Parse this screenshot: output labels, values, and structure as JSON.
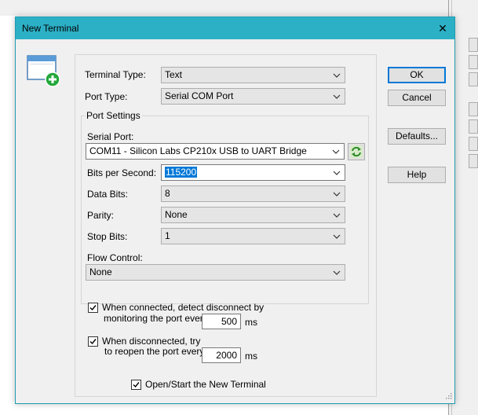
{
  "dialog": {
    "title": "New Terminal",
    "close_glyph": "✕"
  },
  "form": {
    "terminal_type": {
      "label": "Terminal Type:",
      "value": "Text"
    },
    "port_type": {
      "label": "Port Type:",
      "value": "Serial COM Port"
    },
    "port_settings": {
      "legend": "Port Settings",
      "serial_port": {
        "label": "Serial Port:",
        "value": "COM11 - Silicon Labs CP210x USB to UART Bridge"
      },
      "bits_per_second": {
        "label": "Bits per Second:",
        "value": "115200"
      },
      "data_bits": {
        "label": "Data Bits:",
        "value": "8"
      },
      "parity": {
        "label": "Parity:",
        "value": "None"
      },
      "stop_bits": {
        "label": "Stop Bits:",
        "value": "1"
      },
      "flow_control": {
        "label": "Flow Control:",
        "value": "None"
      }
    },
    "detect_disconnect": {
      "checked": true,
      "line1": "When connected, detect disconnect by",
      "line2": "monitoring the port every",
      "value": "500",
      "unit": "ms"
    },
    "reopen": {
      "checked": true,
      "line1": "When disconnected, try",
      "line2": "to reopen the port every",
      "value": "2000",
      "unit": "ms"
    },
    "open_start": {
      "checked": true,
      "label": "Open/Start the New Terminal"
    }
  },
  "buttons": {
    "ok": "OK",
    "cancel": "Cancel",
    "defaults": "Defaults...",
    "help": "Help"
  },
  "icons": {
    "app": "new-terminal-icon",
    "refresh": "refresh-icon",
    "chevron": "chevron-down-icon",
    "check": "check-icon",
    "grip": "resize-grip-icon"
  },
  "colors": {
    "titlebar": "#2cb0c6",
    "accent": "#0078d7",
    "plus_badge": "#22a83a"
  }
}
